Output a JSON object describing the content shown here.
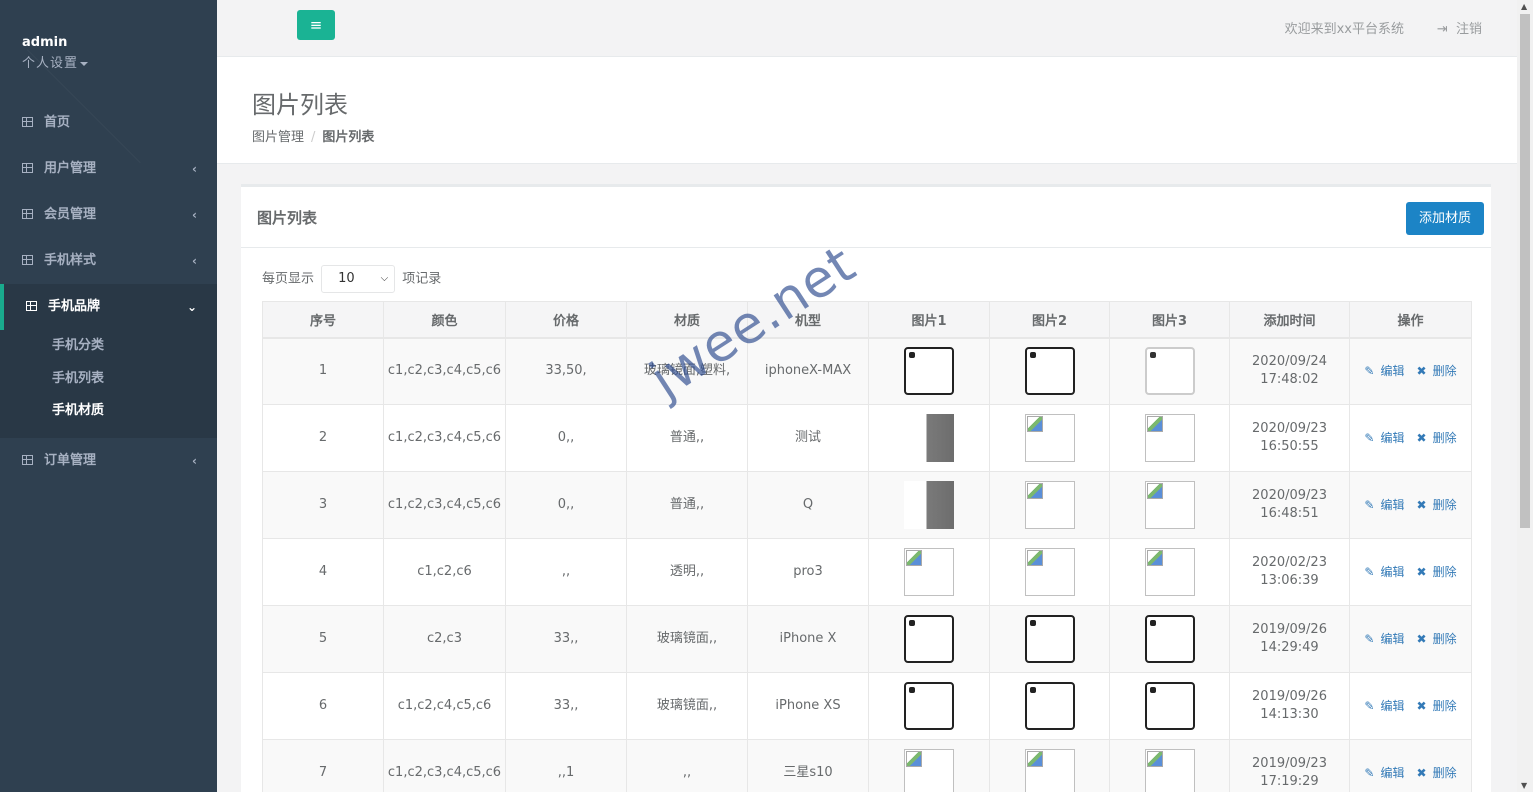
{
  "sidebar": {
    "user": "admin",
    "settings_label": "个人设置",
    "items": [
      {
        "label": "首页",
        "arrow": ""
      },
      {
        "label": "用户管理",
        "arrow": "‹"
      },
      {
        "label": "会员管理",
        "arrow": "‹"
      },
      {
        "label": "手机样式",
        "arrow": "‹"
      },
      {
        "label": "手机品牌",
        "arrow": "⌄"
      },
      {
        "label": "订单管理",
        "arrow": "‹"
      }
    ],
    "subitems": [
      "手机分类",
      "手机列表",
      "手机材质"
    ]
  },
  "topbar": {
    "menu_icon": "≡",
    "welcome": "欢迎来到xx平台系统",
    "logout": "注销"
  },
  "heading": {
    "title": "图片列表",
    "breadcrumb": [
      "图片管理",
      "图片列表"
    ]
  },
  "panel": {
    "title": "图片列表",
    "add_button": "添加材质",
    "length_prefix": "每页显示",
    "length_value": "10",
    "length_suffix": "项记录"
  },
  "table": {
    "columns": [
      "序号",
      "颜色",
      "价格",
      "材质",
      "机型",
      "图片1",
      "图片2",
      "图片3",
      "添加时间",
      "操作"
    ],
    "rows": [
      {
        "id": "1",
        "color": "c1,c2,c3,c4,c5,c6",
        "price": "33,50,",
        "material": "玻璃镜面,塑料,",
        "model": "iphoneX-MAX",
        "img1": "phone",
        "img2": "phone",
        "img3": "phone light",
        "date": "2020/09/24",
        "time": "17:48:02"
      },
      {
        "id": "2",
        "color": "c1,c2,c3,c4,c5,c6",
        "price": "0,,",
        "material": "普通,,",
        "model": "测试",
        "img1": "photo",
        "img2": "broken",
        "img3": "broken",
        "date": "2020/09/23",
        "time": "16:50:55"
      },
      {
        "id": "3",
        "color": "c1,c2,c3,c4,c5,c6",
        "price": "0,,",
        "material": "普通,,",
        "model": "Q",
        "img1": "photo",
        "img2": "broken",
        "img3": "broken",
        "date": "2020/09/23",
        "time": "16:48:51"
      },
      {
        "id": "4",
        "color": "c1,c2,c6",
        "price": ",,",
        "material": "透明,,",
        "model": "pro3",
        "img1": "broken",
        "img2": "broken",
        "img3": "broken",
        "date": "2020/02/23",
        "time": "13:06:39"
      },
      {
        "id": "5",
        "color": "c2,c3",
        "price": "33,,",
        "material": "玻璃镜面,,",
        "model": "iPhone X",
        "img1": "phone",
        "img2": "phone",
        "img3": "phone",
        "date": "2019/09/26",
        "time": "14:29:49"
      },
      {
        "id": "6",
        "color": "c1,c2,c4,c5,c6",
        "price": "33,,",
        "material": "玻璃镜面,,",
        "model": "iPhone XS",
        "img1": "phone",
        "img2": "phone",
        "img3": "phone",
        "date": "2019/09/26",
        "time": "14:13:30"
      },
      {
        "id": "7",
        "color": "c1,c2,c3,c4,c5,c6",
        "price": ",,1",
        "material": ",,",
        "model": "三星s10",
        "img1": "broken",
        "img2": "broken",
        "img3": "broken",
        "date": "2019/09/23",
        "time": "17:19:29"
      }
    ],
    "edit_label": "编辑",
    "delete_label": "删除"
  },
  "watermark": "jwee.net"
}
